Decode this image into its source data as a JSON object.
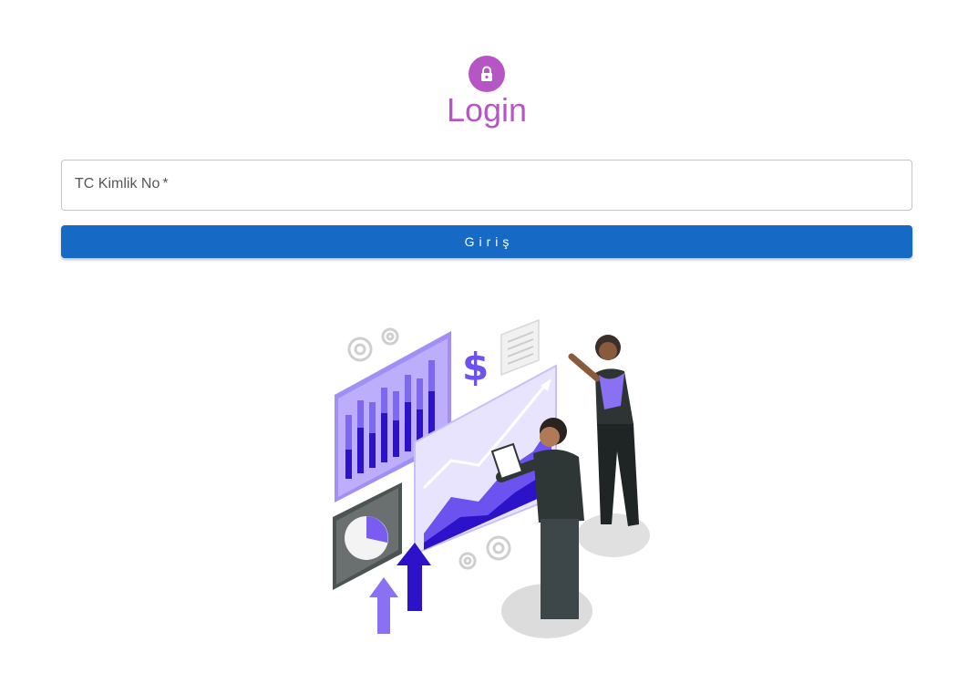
{
  "header": {
    "title": "Login",
    "icon": "lock-icon",
    "accent_color": "#b556c4"
  },
  "form": {
    "tc_field": {
      "label": "TC Kimlik No",
      "required_marker": "*",
      "value": ""
    },
    "submit_label": "Giriş",
    "submit_color": "#1769c6"
  },
  "illustration": {
    "name": "business-analytics-illustration",
    "primary_color": "#7b5cf0"
  }
}
